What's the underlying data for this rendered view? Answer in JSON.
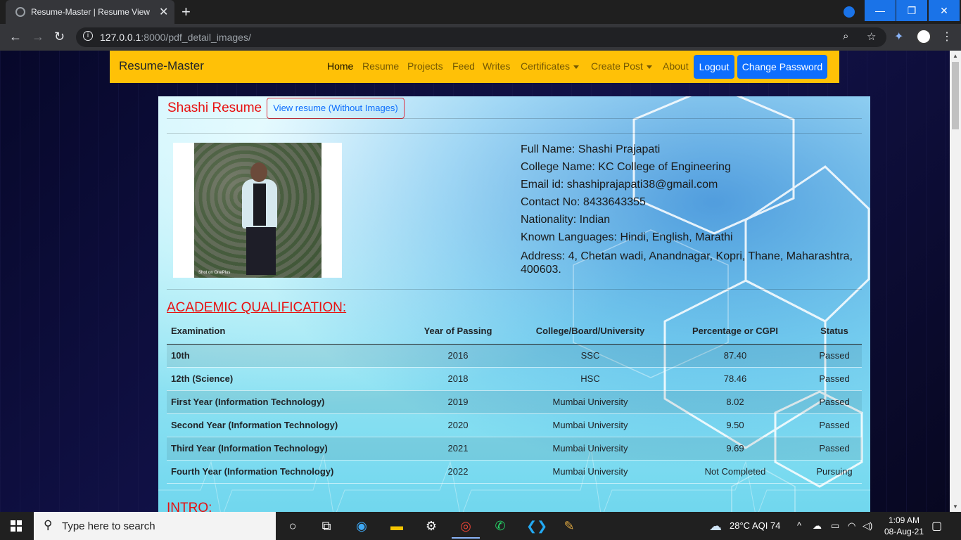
{
  "browser": {
    "tab_title": "Resume-Master | Resume View",
    "url_host": "127.0.0.1",
    "url_rest": ":8000/pdf_detail_images/"
  },
  "navbar": {
    "brand": "Resume-Master",
    "items": [
      {
        "label": "Home",
        "active": true
      },
      {
        "label": "Resume"
      },
      {
        "label": "Projects"
      },
      {
        "label": "Feed"
      },
      {
        "label": "Writes"
      },
      {
        "label": "Certificates",
        "dropdown": true
      },
      {
        "label": "Create Post",
        "dropdown": true
      },
      {
        "label": "About"
      }
    ],
    "logout": "Logout",
    "change_password": "Change Password"
  },
  "resume": {
    "title": "Shashi Resume",
    "view_button": "View resume (Without Images)",
    "photo_watermark": "Shot on OnePlus",
    "info": {
      "full_name": "Full Name: Shashi Prajapati",
      "college": "College Name: KC College of Engineering",
      "email": "Email id: shashiprajapati38@gmail.com",
      "contact": "Contact No: 8433643355",
      "nationality": "Nationality: Indian",
      "languages": "Known Languages: Hindi, English, Marathi",
      "address": "Address: 4, Chetan wadi, Anandnagar, Kopri, Thane, Maharashtra, 400603."
    },
    "academic_heading": "ACADEMIC QUALIFICATION:",
    "table_headers": [
      "Examination",
      "Year of Passing",
      "College/Board/University",
      "Percentage or CGPI",
      "Status"
    ],
    "rows": [
      [
        "10th",
        "2016",
        "SSC",
        "87.40",
        "Passed"
      ],
      [
        "12th (Science)",
        "2018",
        "HSC",
        "78.46",
        "Passed"
      ],
      [
        "First Year (Information Technology)",
        "2019",
        "Mumbai University",
        "8.02",
        "Passed"
      ],
      [
        "Second Year (Information Technology)",
        "2020",
        "Mumbai University",
        "9.50",
        "Passed"
      ],
      [
        "Third Year (Information Technology)",
        "2021",
        "Mumbai University",
        "9.69",
        "Passed"
      ],
      [
        "Fourth Year (Information Technology)",
        "2022",
        "Mumbai University",
        "Not Completed",
        "Pursuing"
      ]
    ],
    "intro_heading": "INTRO:"
  },
  "taskbar": {
    "search_placeholder": "Type here to search",
    "weather": "28°C  AQI 74",
    "time": "1:09 AM",
    "date": "08-Aug-21"
  },
  "colors": {
    "navbar_bg": "#ffc107",
    "button_blue": "#0d6efd",
    "heading_red": "#e81010"
  }
}
